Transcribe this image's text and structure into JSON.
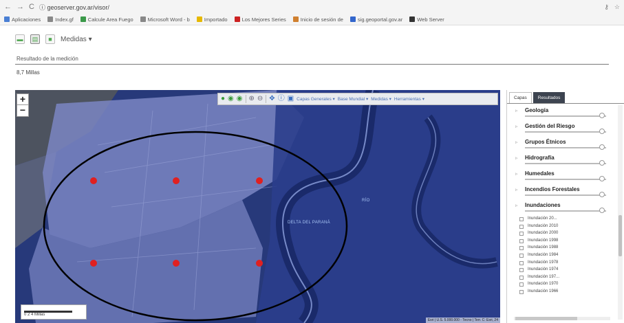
{
  "browser": {
    "back": "←",
    "forward": "→",
    "reload": "C",
    "address": "ⓘ geoserver.gov.ar/visor/",
    "bookmarks": [
      {
        "label": "Aplicaciones",
        "color": "#4a7fd4"
      },
      {
        "label": "Index.gf",
        "color": "#888"
      },
      {
        "label": "Calcule Area Fuego",
        "color": "#3b9a4a"
      },
      {
        "label": "Microsoft Word - b",
        "color": "#888"
      },
      {
        "label": "Importado",
        "color": "#e6b800"
      },
      {
        "label": "Los Mejores Series",
        "color": "#cc2222"
      },
      {
        "label": "Inicio de sesión de",
        "color": "#d08030"
      },
      {
        "label": "sig.geoportal.gov.ar",
        "color": "#3366cc"
      },
      {
        "label": "Web Server",
        "color": "#333"
      }
    ]
  },
  "toolbar": {
    "menu_label": "Medidas ▾"
  },
  "measure": {
    "label": "Resultado de la medición",
    "value": "8,7 Millas"
  },
  "map": {
    "toolbar_items": [
      "Capas Generales ▾",
      "Base Mundial ▾",
      "Medidas ▾",
      "Herramientas ▾"
    ],
    "label_delta": "DELTA DEL PARANÁ",
    "label_water": "RÍO",
    "scale": "0     2     4 Millas",
    "attribution": "Esri | U.S. 5.000.000 - Tecno | Terr. C: Esri, 24"
  },
  "panel": {
    "tabs": [
      "Capas",
      "Resultados"
    ],
    "layers": [
      {
        "name": "Geología"
      },
      {
        "name": "Gestión del Riesgo"
      },
      {
        "name": "Grupos Étnicos"
      },
      {
        "name": "Hidrografía"
      },
      {
        "name": "Humedales"
      },
      {
        "name": "Incendios Forestales"
      },
      {
        "name": "Inundaciones"
      }
    ],
    "sublayers": [
      "Inundación 20...",
      "Inundación 2010",
      "Inundación 2000",
      "Inundación 1998",
      "Inundación 1988",
      "Inundación 1984",
      "Inundación 1978",
      "Inundación 1974",
      "Inundación 197...",
      "Inundación 1970",
      "Inundación 1966"
    ]
  }
}
